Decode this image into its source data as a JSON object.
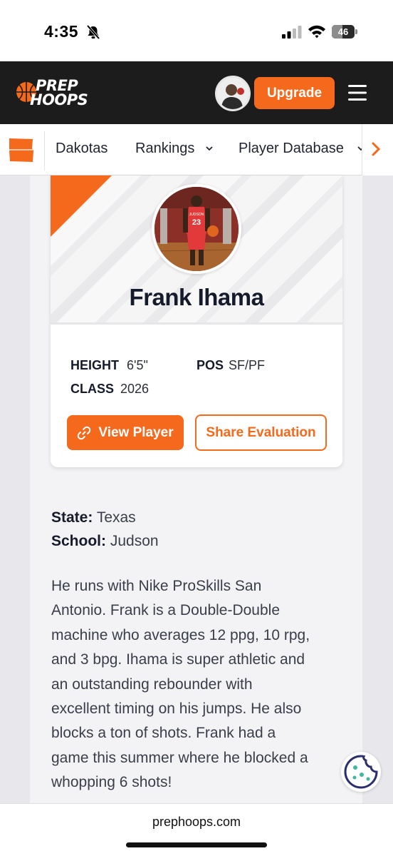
{
  "status_bar": {
    "time": "4:35",
    "battery": "46",
    "battery_level": 0.46
  },
  "header": {
    "logo_line1": "PREP",
    "logo_line2": "HOOPS",
    "upgrade_label": "Upgrade"
  },
  "nav": {
    "items": [
      {
        "label": "Dakotas"
      },
      {
        "label": "Rankings"
      },
      {
        "label": "Player Database"
      }
    ]
  },
  "player": {
    "name": "Frank Ihama",
    "jersey": "23",
    "jersey_text": "JUDSON",
    "height_label": "HEIGHT",
    "height_value": "6'5\"",
    "pos_label": "POS",
    "pos_value": "SF/PF",
    "class_label": "CLASS",
    "class_value": "2026",
    "view_player_label": "View Player",
    "share_label": "Share Evaluation"
  },
  "details": {
    "state_label": "State:",
    "state_value": "Texas",
    "school_label": "School:",
    "school_value": "Judson"
  },
  "bio": {
    "lines": [
      "He runs with Nike ProSkills San",
      "Antonio. Frank is a Double-Double",
      "machine who averages 12 ppg, 10 rpg,",
      "and 3 bpg. Ihama is super athletic and",
      "an outstanding rebounder with",
      "excellent timing on his jumps. He also",
      "blocks a ton of shots. Frank had a",
      "game this summer where he blocked a",
      "whopping 6 shots!"
    ]
  },
  "footer": {
    "domain": "prephoops.com"
  },
  "colors": {
    "accent": "#f5691c",
    "header_bg": "#1c1c1c",
    "name_text": "#161b2c"
  },
  "icons": [
    "bell-slash-icon",
    "signal-icon",
    "wifi-icon",
    "battery-icon",
    "menu-icon",
    "chevron-down-icon",
    "chevron-right-icon",
    "link-icon",
    "cookie-icon"
  ]
}
